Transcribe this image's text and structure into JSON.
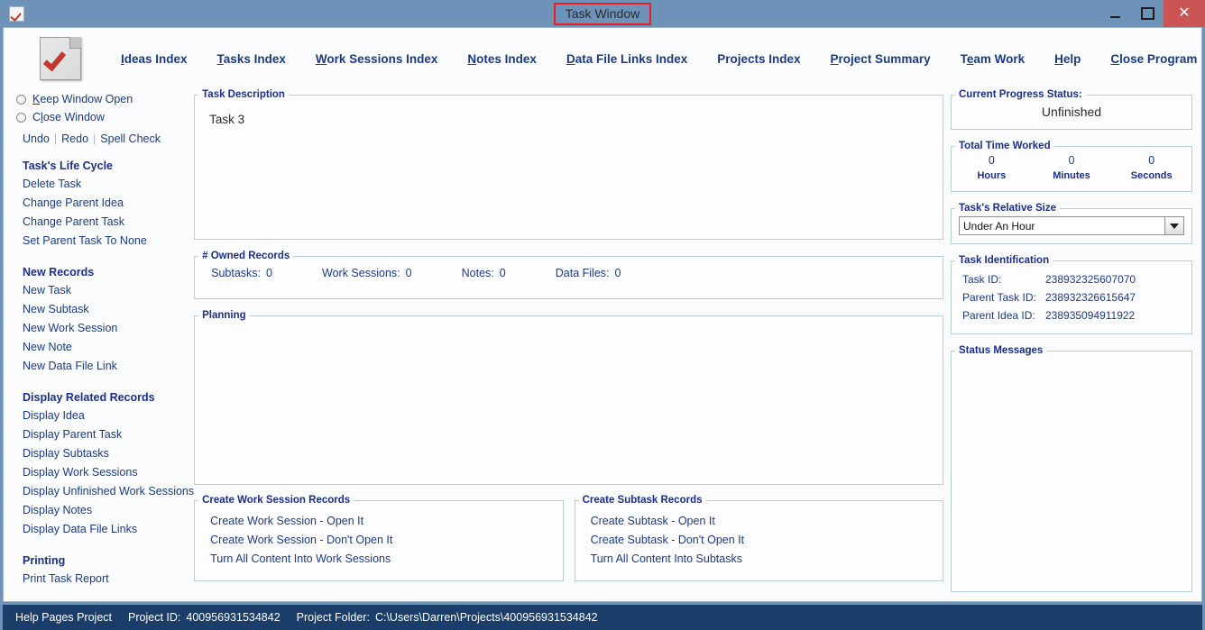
{
  "window": {
    "title": "Task Window",
    "icon": "task-check-icon",
    "minimize_label": "",
    "maximize_label": "",
    "close_label": "✕",
    "title_highlight_color": "#ec1c24",
    "titlebar_color": "#6f93b8",
    "close_button_color": "#cb5555"
  },
  "topnav": {
    "logo": "document-check-logo",
    "items": [
      {
        "label": "Ideas Index",
        "accesskey": "I"
      },
      {
        "label": "Tasks Index",
        "accesskey": "T"
      },
      {
        "label": "Work Sessions Index",
        "accesskey": "W"
      },
      {
        "label": "Notes Index",
        "accesskey": "N"
      },
      {
        "label": "Data File Links Index",
        "accesskey": "D"
      },
      {
        "label": "Projects Index",
        "accesskey": ""
      },
      {
        "label": "Project Summary",
        "accesskey": "P"
      },
      {
        "label": "Team Work",
        "accesskey": "e"
      },
      {
        "label": "Help",
        "accesskey": "H"
      },
      {
        "label": "Close Program",
        "accesskey": "C"
      }
    ]
  },
  "sidebar": {
    "radios": [
      {
        "label": "Keep Window Open",
        "accesskey": "K",
        "selected": false
      },
      {
        "label": "Close Window",
        "accesskey": "l",
        "selected": false
      }
    ],
    "edit_actions": [
      "Undo",
      "Redo",
      "Spell Check"
    ],
    "groups": [
      {
        "heading": "Task's Life Cycle",
        "items": [
          "Delete Task",
          "Change Parent Idea",
          "Change Parent Task",
          "Set Parent Task To None"
        ]
      },
      {
        "heading": "New Records",
        "items": [
          "New Task",
          "New Subtask",
          "New Work Session",
          "New Note",
          "New Data File Link"
        ]
      },
      {
        "heading": "Display Related Records",
        "items": [
          "Display Idea",
          "Display Parent Task",
          "Display Subtasks",
          "Display Work Sessions",
          "Display Unfinished Work Sessions",
          "Display Notes",
          "Display Data File Links"
        ]
      },
      {
        "heading": "Printing",
        "items": [
          "Print Task Report"
        ]
      }
    ]
  },
  "center": {
    "task_description": {
      "legend": "Task Description",
      "value": "Task 3"
    },
    "owned_records": {
      "legend": "# Owned Records",
      "cells": [
        {
          "label": "Subtasks:",
          "value": "0"
        },
        {
          "label": "Work Sessions:",
          "value": "0"
        },
        {
          "label": "Notes:",
          "value": "0"
        },
        {
          "label": "Data Files:",
          "value": "0"
        }
      ]
    },
    "planning": {
      "legend": "Planning",
      "value": ""
    },
    "work_session_records": {
      "legend": "Create Work Session Records",
      "actions": [
        "Create Work Session - Open It",
        "Create Work Session - Don't Open It",
        "Turn All Content Into Work Sessions"
      ]
    },
    "subtask_records": {
      "legend": "Create Subtask Records",
      "actions": [
        "Create Subtask - Open It",
        "Create Subtask - Don't Open It",
        "Turn All Content Into Subtasks"
      ]
    }
  },
  "right": {
    "progress": {
      "legend": "Current Progress Status:",
      "value": "Unfinished"
    },
    "time_worked": {
      "legend": "Total Time Worked",
      "cells": [
        {
          "value": "0",
          "unit": "Hours"
        },
        {
          "value": "0",
          "unit": "Minutes"
        },
        {
          "value": "0",
          "unit": "Seconds"
        }
      ]
    },
    "relative_size": {
      "legend": "Task's Relative Size",
      "selected": "Under An Hour"
    },
    "identification": {
      "legend": "Task Identification",
      "rows": [
        {
          "label": "Task ID:",
          "value": "238932325607070"
        },
        {
          "label": "Parent Task ID:",
          "value": "238932326615647"
        },
        {
          "label": "Parent Idea ID:",
          "value": "238935094911922"
        }
      ]
    },
    "status_messages": {
      "legend": "Status Messages",
      "value": ""
    }
  },
  "statusbar": {
    "project_name": "Help Pages Project",
    "project_id_label": "Project ID:",
    "project_id": "400956931534842",
    "project_folder_label": "Project Folder:",
    "project_folder": "C:\\Users\\Darren\\Projects\\400956931534842"
  }
}
